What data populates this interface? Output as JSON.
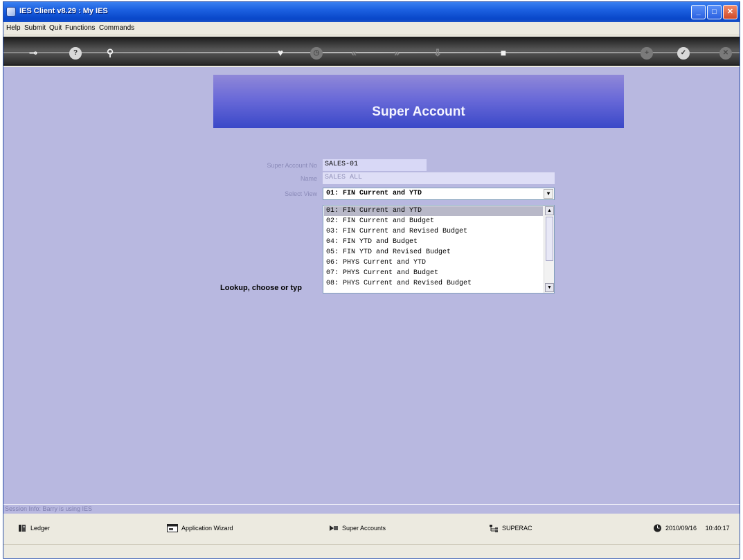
{
  "window": {
    "title": "IES Client v8.29 : My IES"
  },
  "menu": {
    "items": [
      "Help",
      "Submit",
      "Quit",
      "Functions",
      "Commands"
    ]
  },
  "toolbar": {
    "icons": [
      "key-icon",
      "help-icon",
      "search-icon",
      "heart-icon",
      "clock-icon",
      "rewind-icon",
      "fast-forward-icon",
      "export-icon",
      "stop-icon",
      "add-icon",
      "ok-icon",
      "close-icon"
    ]
  },
  "banner": {
    "title": "Super Account"
  },
  "form": {
    "account_label": "Super Account No",
    "account_value": "SALES-01",
    "name_label": "Name",
    "name_value": "SALES ALL",
    "view_label": "Select View",
    "view_value": "01: FIN Current and YTD"
  },
  "dropdown": {
    "options": [
      "01: FIN Current and YTD",
      "02: FIN Current and Budget",
      "03: FIN Current and Revised Budget",
      "04: FIN YTD and Budget",
      "05: FIN YTD and Revised Budget",
      "06: PHYS Current and YTD",
      "07: PHYS Current and Budget",
      "08: PHYS Current and Revised Budget"
    ],
    "selected_index": 0
  },
  "prompt": "Lookup, choose or typ",
  "session": "Session Info: Barry is using IES",
  "status": {
    "ledger": "Ledger",
    "wizard": "Application Wizard",
    "super_accounts": "Super Accounts",
    "code": "SUPERAC",
    "date": "2010/09/16",
    "time": "10:40:17"
  }
}
